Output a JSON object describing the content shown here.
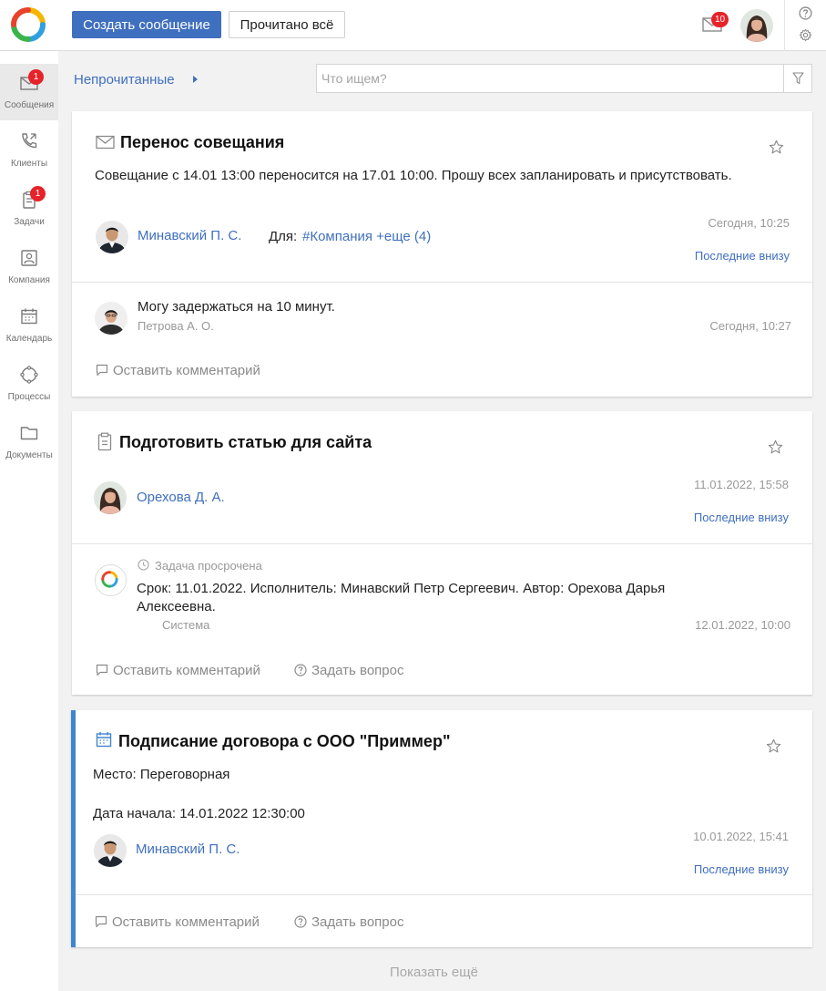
{
  "topbar": {
    "create_label": "Создать сообщение",
    "read_all_label": "Прочитано всё",
    "mail_badge": "10"
  },
  "sidebar": {
    "items": [
      {
        "label": "Сообщения",
        "badge": "1"
      },
      {
        "label": "Клиенты"
      },
      {
        "label": "Задачи",
        "badge": "1"
      },
      {
        "label": "Компания"
      },
      {
        "label": "Календарь"
      },
      {
        "label": "Процессы"
      },
      {
        "label": "Документы"
      }
    ]
  },
  "filter": {
    "label": "Непрочитанные",
    "search_placeholder": "Что ищем?"
  },
  "cards": [
    {
      "title": "Перенос совещания",
      "text": "Совещание с 14.01 13:00 переносится на 17.01 10:00. Прошу всех запланировать и присутствовать.",
      "author": "Минавский П. С.",
      "for_label": "Для:",
      "recipients": "#Компания +еще (4)",
      "time": "Сегодня, 10:25",
      "latest_label": "Последние внизу",
      "comment": {
        "text": "Могу задержаться на 10 минут.",
        "author": "Петрова А. О.",
        "time": "Сегодня, 10:27"
      },
      "leave_comment": "Оставить комментарий"
    },
    {
      "title": "Подготовить статью для сайта",
      "author": "Орехова Д. А.",
      "time": "11.01.2022, 15:58",
      "latest_label": "Последние внизу",
      "system_note": {
        "status": "Задача просрочена",
        "text": "Срок: 11.01.2022. Исполнитель: Минавский Петр Сергеевич. Автор: Орехова Дарья Алексеевна.",
        "author": "Система",
        "time": "12.01.2022, 10:00"
      },
      "leave_comment": "Оставить комментарий",
      "ask_question": "Задать вопрос"
    },
    {
      "title": "Подписание договора с ООО \"Приммер\"",
      "place": "Место: Переговорная",
      "start": "Дата начала: 14.01.2022 12:30:00",
      "author": "Минавский П. С.",
      "time": "10.01.2022, 15:41",
      "latest_label": "Последние внизу",
      "leave_comment": "Оставить комментарий",
      "ask_question": "Задать вопрос"
    }
  ],
  "show_more": "Показать ещё",
  "colors": {
    "accent": "#3f6fbf",
    "badge": "#e5232a",
    "event_stripe": "#3f86cf"
  },
  "icons": [
    "app-logo",
    "mail-icon",
    "help-icon",
    "gear-icon",
    "phone-icon",
    "clipboard-icon",
    "company-icon",
    "calendar-icon",
    "process-icon",
    "folder-icon",
    "filter-icon",
    "star-icon",
    "comment-icon",
    "question-icon",
    "clock-icon"
  ]
}
